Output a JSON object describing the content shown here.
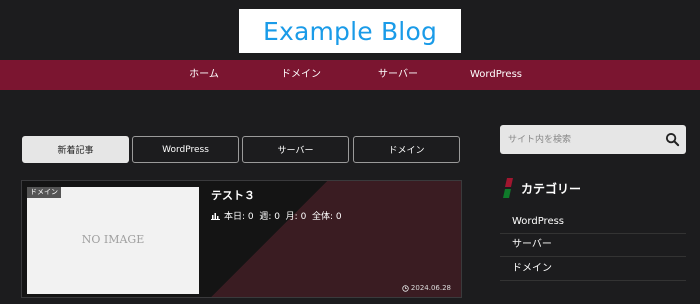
{
  "header": {
    "logo_text": "Example Blog"
  },
  "nav": {
    "items": [
      {
        "label": "ホーム"
      },
      {
        "label": "ドメイン"
      },
      {
        "label": "サーバー"
      },
      {
        "label": "WordPress"
      }
    ]
  },
  "tabs": {
    "items": [
      {
        "label": "新着記事"
      },
      {
        "label": "WordPress"
      },
      {
        "label": "サーバー"
      },
      {
        "label": "ドメイン"
      }
    ]
  },
  "post": {
    "category_label": "ドメイン",
    "no_image_text": "NO IMAGE",
    "title": "テスト３",
    "stats": "本日: 0  週: 0  月: 0  全体: 0",
    "date": "2024.06.28"
  },
  "sidebar": {
    "search_placeholder": "サイト内を検索",
    "category_heading": "カテゴリー",
    "categories": [
      {
        "label": "WordPress"
      },
      {
        "label": "サーバー"
      },
      {
        "label": "ドメイン"
      }
    ]
  },
  "colors": {
    "background": "#1c1c1e",
    "nav_bar": "#7b1530",
    "logo_text": "#1a9be8",
    "active_tab": "#e6e6e6"
  }
}
